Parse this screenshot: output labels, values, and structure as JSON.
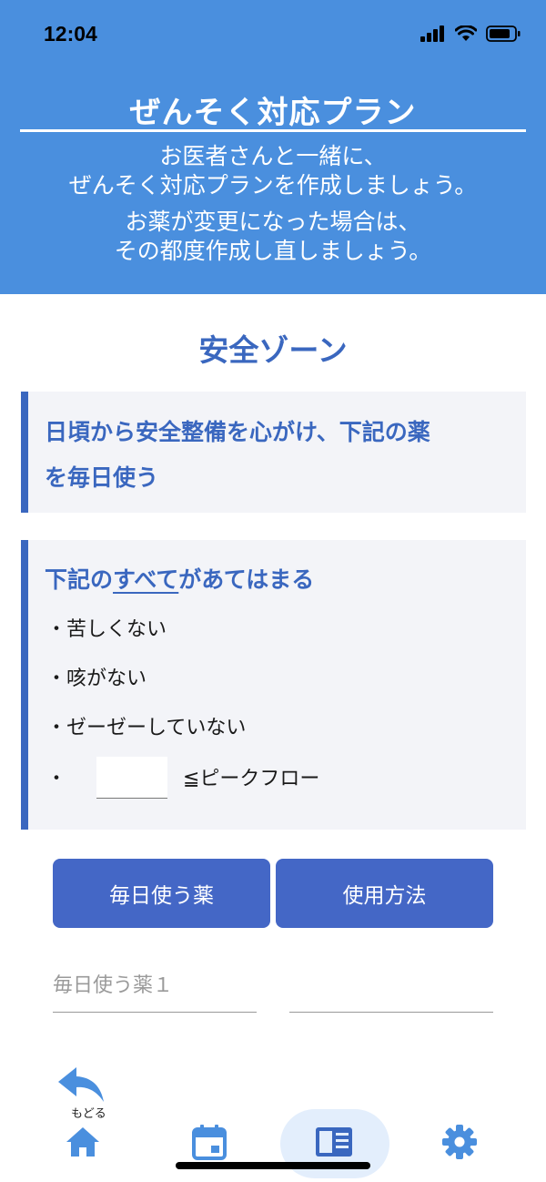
{
  "status_bar": {
    "time": "12:04"
  },
  "header": {
    "title": "ぜんそく対応プラン",
    "intro_line1": "お医者さんと一緒に、",
    "intro_line2": "ぜんそく対応プランを作成しましょう。",
    "intro_line3": "お薬が変更になった場合は、",
    "intro_line4": "その都度作成し直しましょう。"
  },
  "zone": {
    "title": "安全ゾーン",
    "instruction_line1": "日頃から安全整備を心がけ、下記の薬",
    "instruction_line2": "を毎日使う",
    "conditions_pre": "下記の",
    "conditions_emph": "すべて",
    "conditions_post": "があてはまる",
    "conditions": [
      "・苦しくない",
      "・咳がない",
      "・ゼーゼーしていない"
    ],
    "peak_flow_bullet": "・",
    "peak_flow_value": "",
    "peak_flow_label": "≦ピークフロー"
  },
  "buttons": {
    "daily_medicine": "毎日使う薬",
    "usage": "使用方法"
  },
  "fields": {
    "medicine1_placeholder": "毎日使う薬１",
    "usage1_placeholder": ""
  },
  "nav": {
    "back_label": "もどる"
  },
  "colors": {
    "header_bg": "#4a8fde",
    "accent": "#3a67bf",
    "button": "#4467c6",
    "card_bg": "#f3f4f8"
  }
}
